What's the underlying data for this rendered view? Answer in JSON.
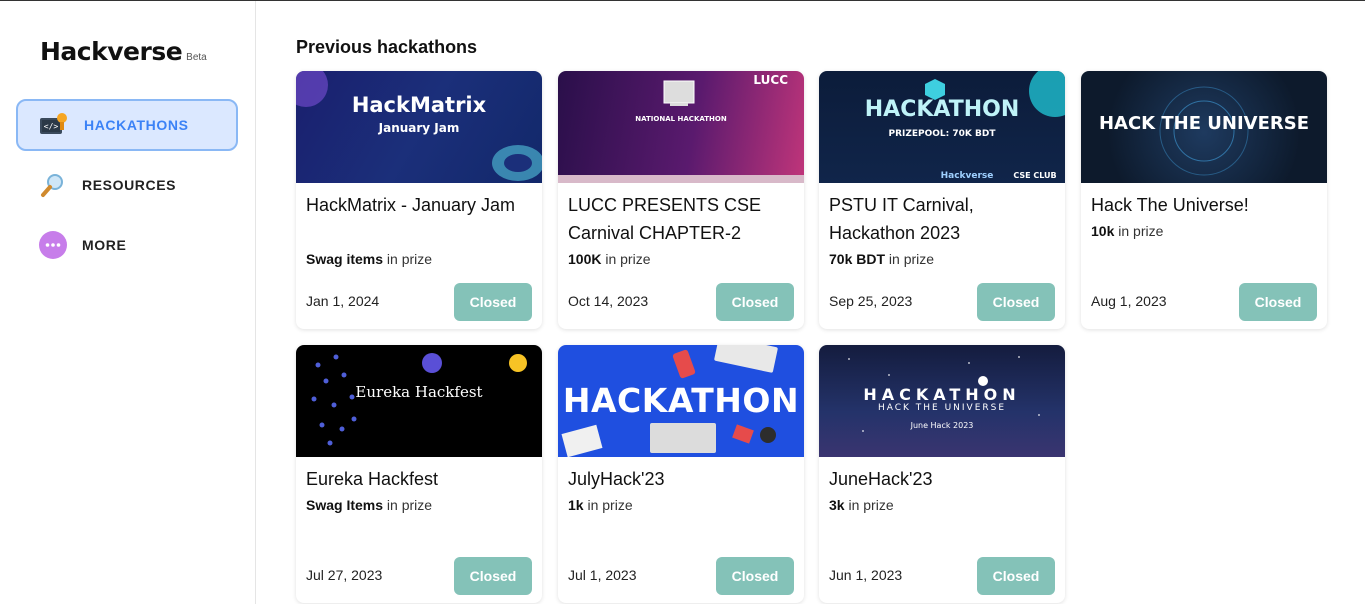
{
  "sidebar": {
    "brand": "Hackverse",
    "beta": "Beta",
    "items": [
      {
        "label": "HACKATHONS",
        "icon": "hackathon-icon"
      },
      {
        "label": "RESOURCES",
        "icon": "magnifier-icon"
      },
      {
        "label": "MORE",
        "icon": "more-dots-icon"
      }
    ]
  },
  "main": {
    "title": "Previous hackathons",
    "cards": [
      {
        "title": "HackMatrix - January Jam",
        "prize_value": "Swag items",
        "prize_suffix": "in prize",
        "date": "Jan 1, 2024",
        "status": "Closed",
        "banner": [
          "HackMatrix",
          "January Jam"
        ]
      },
      {
        "title": "LUCC PRESENTS CSE Carnival CHAPTER-2",
        "prize_value": "100K",
        "prize_suffix": "in prize",
        "date": "Oct 14, 2023",
        "status": "Closed",
        "banner": [
          "NATIONAL HACKATHON",
          "LUCC"
        ]
      },
      {
        "title": "PSTU IT Carnival, Hackathon 2023",
        "prize_value": "70k BDT",
        "prize_suffix": "in prize",
        "date": "Sep 25, 2023",
        "status": "Closed",
        "banner": [
          "HACKATHON",
          "PRIZEPOOL: 70K BDT",
          "Hackverse",
          "CSE CLUB"
        ]
      },
      {
        "title": "Hack The Universe!",
        "prize_value": "10k",
        "prize_suffix": "in prize",
        "date": "Aug 1, 2023",
        "status": "Closed",
        "banner": [
          "HACK THE UNIVERSE"
        ]
      },
      {
        "title": "Eureka Hackfest",
        "prize_value": "Swag Items",
        "prize_suffix": "in prize",
        "date": "Jul 27, 2023",
        "status": "Closed",
        "banner": [
          "Eureka Hackfest"
        ]
      },
      {
        "title": "JulyHack'23",
        "prize_value": "1k",
        "prize_suffix": "in prize",
        "date": "Jul 1, 2023",
        "status": "Closed",
        "banner": [
          "HACKATHON"
        ]
      },
      {
        "title": "JuneHack'23",
        "prize_value": "3k",
        "prize_suffix": "in prize",
        "date": "Jun 1, 2023",
        "status": "Closed",
        "banner": [
          "HACKATHON",
          "HACK THE UNIVERSE",
          "June Hack 2023"
        ]
      }
    ]
  },
  "colors": {
    "accent": "#3b82f6",
    "active_bg": "#dbe8ff",
    "closed_button": "#84c2b8"
  }
}
